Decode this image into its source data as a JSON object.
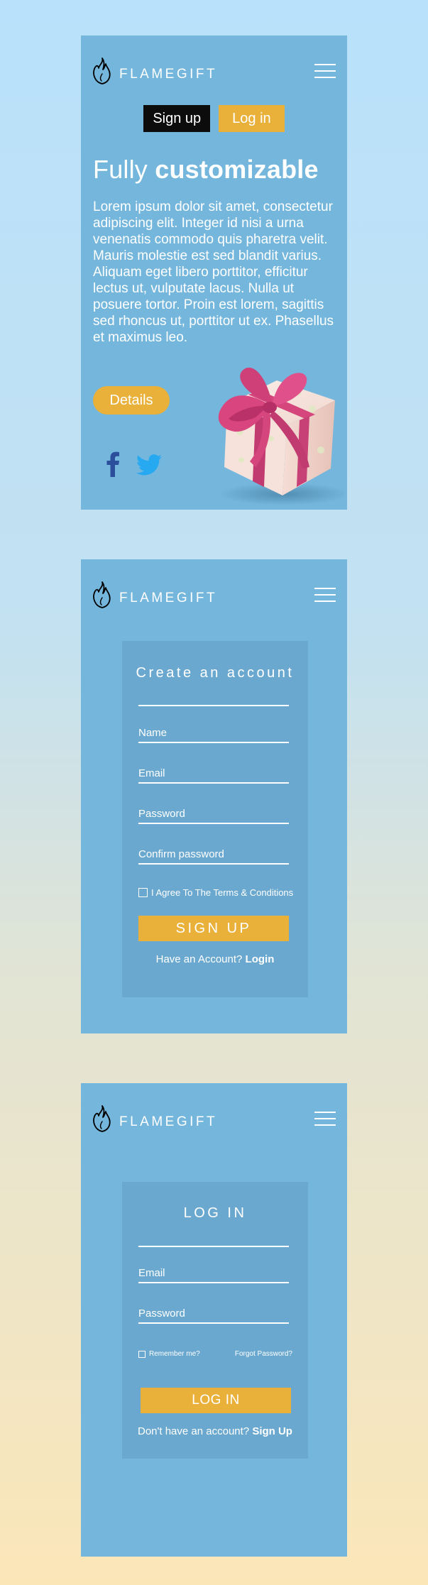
{
  "brand": {
    "name": "FLAMEGIFT"
  },
  "hero": {
    "signup_label": "Sign up",
    "login_label": "Log in",
    "title_light": "Fully ",
    "title_bold": "customizable",
    "body": "Lorem ipsum dolor sit amet, consectetur adipiscing elit. Integer id nisi a urna venenatis commodo quis pharetra velit. Mauris molestie est sed blandit varius. Aliquam eget libero porttitor, efficitur lectus ut, vulputate lacus. Nulla ut posuere tortor. Proin est lorem, sagittis sed rhoncus ut, porttitor ut ex. Phasellus et maximus leo.",
    "details_label": "Details",
    "social": [
      "facebook-icon",
      "twitter-icon"
    ]
  },
  "signup_form": {
    "title": "Create an account",
    "fields": [
      "Name",
      "Email",
      "Password",
      "Confirm password"
    ],
    "agree_label": "I Agree To The Terms & Conditions",
    "submit_label": "SIGN UP",
    "footer_text": "Have an Account? ",
    "footer_link": "Login"
  },
  "login_form": {
    "title": "LOG IN",
    "fields": [
      "Email",
      "Password"
    ],
    "remember_label": "Remember me?",
    "forgot_label": "Forgot Password?",
    "submit_label": "LOG IN",
    "footer_text": "Don't have an account? ",
    "footer_link": "Sign Up"
  },
  "colors": {
    "panel": "#74b6dc",
    "card": "#6aa8cf",
    "accent": "#e9b13a",
    "dark_button": "#0c0c0c",
    "facebook": "#2b4f9a",
    "twitter": "#27a9f1"
  }
}
